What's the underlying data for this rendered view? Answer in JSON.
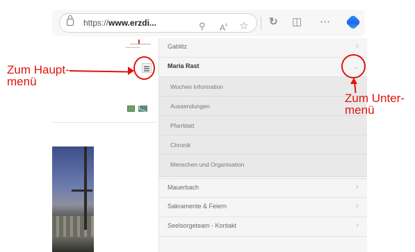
{
  "browser": {
    "url_prefix": "https://",
    "url_domain": "www.erzdi...",
    "icons": [
      "lock-icon",
      "zoom-icon",
      "read-aloud-icon",
      "favorite-star-icon",
      "refresh-icon",
      "split-screen-icon",
      "more-icon",
      "copilot-icon"
    ]
  },
  "site": {
    "logo": "erzdiozese-wien-logo",
    "social_icons": [
      "share-icon",
      "mail-icon"
    ]
  },
  "menu": {
    "items": [
      {
        "label": "Gablitz",
        "expanded": false
      },
      {
        "label": "Maria Rast",
        "expanded": true
      },
      {
        "label": "Mauerbach",
        "expanded": false
      },
      {
        "label": "Sakramente & Feiern",
        "expanded": false
      },
      {
        "label": "Seelsorgeteam - Kontakt",
        "expanded": false
      }
    ],
    "subitems": [
      {
        "label": "Wochen Information"
      },
      {
        "label": "Aussendungen"
      },
      {
        "label": "Pfarrblatt"
      },
      {
        "label": "Chronik"
      },
      {
        "label": "Menschen und Organisation"
      }
    ]
  },
  "annotations": {
    "main_menu_line1": "Zum Haupt-",
    "main_menu_line2": "menü",
    "sub_menu_line1": "Zum Unter-",
    "sub_menu_line2": "menü",
    "color": "#e3120b"
  }
}
